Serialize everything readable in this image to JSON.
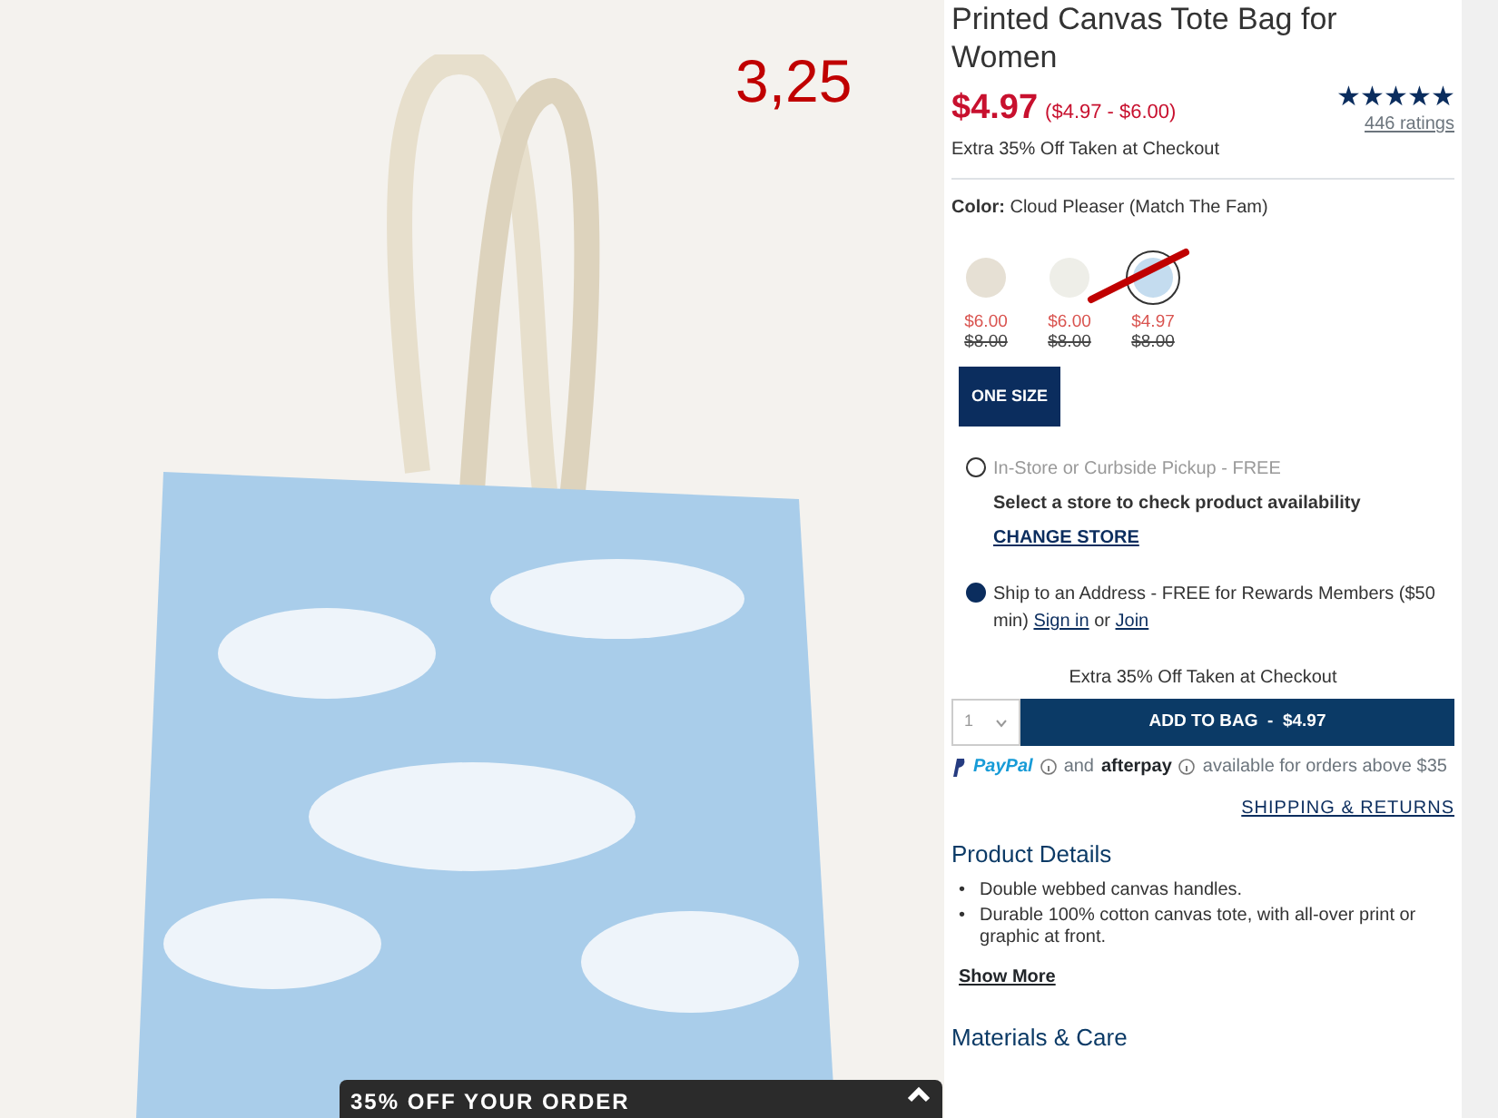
{
  "annotation": {
    "text": "3,25"
  },
  "product": {
    "title": "Printed Canvas Tote Bag for Women",
    "price": "$4.97",
    "price_range": "($4.97 - $6.00)",
    "promo_note": "Extra 35% Off Taken at Checkout",
    "stars": 5,
    "ratings": "446 ratings"
  },
  "color": {
    "label": "Color:",
    "value": "Cloud Pleaser (Match The Fam)"
  },
  "swatches": [
    {
      "color": "#e6e0d4",
      "sale_price": "$6.00",
      "original_price": "$8.00",
      "selected": false
    },
    {
      "color": "#eeeee8",
      "sale_price": "$6.00",
      "original_price": "$8.00",
      "selected": false
    },
    {
      "color": "#c4dcef",
      "sale_price": "$4.97",
      "original_price": "$8.00",
      "selected": true
    }
  ],
  "size": {
    "label": "ONE SIZE",
    "selected": true
  },
  "fulfillment": [
    {
      "label": "In-Store or Curbside Pickup - FREE",
      "selected": false,
      "note": "Select a store to check product availability",
      "link": "CHANGE STORE"
    },
    {
      "label": "Ship to an Address - FREE for Rewards Members ($50 min)",
      "selected": true,
      "sign_in": "Sign in",
      "or": "or",
      "join": "Join"
    }
  ],
  "checkout_note": "Extra 35% Off Taken at Checkout",
  "quantity": "1",
  "add_button": "ADD TO BAG  -  $4.97",
  "payment": {
    "paypal": "PayPal",
    "and": "and",
    "afterpay": "afterpay",
    "note": "available for orders above $35"
  },
  "shipping_link": "SHIPPING & RETURNS",
  "details": {
    "heading": "Product Details",
    "bullet_marker": "•",
    "bullets": [
      "Double webbed canvas handles.",
      "Durable 100% cotton canvas tote, with all-over print or graphic at front."
    ],
    "show_more": "Show More"
  },
  "materials_heading": "Materials & Care",
  "promo_bar": {
    "text": "35% OFF YOUR ORDER"
  }
}
